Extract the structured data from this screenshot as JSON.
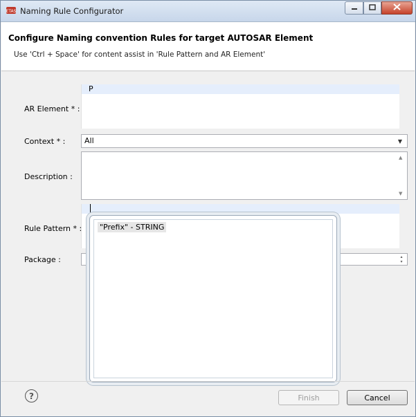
{
  "window": {
    "title": "Naming Rule Configurator",
    "icons": {
      "app": "app-logo-icon",
      "minimize": "minimize-icon",
      "maximize": "maximize-icon",
      "close": "close-icon"
    }
  },
  "header": {
    "title": "Configure Naming convention Rules for target AUTOSAR Element",
    "description": "Use  'Ctrl + Space' for content assist in 'Rule Pattern and AR Element'"
  },
  "form": {
    "ar_element": {
      "label": "AR Element * :",
      "value": "P"
    },
    "context": {
      "label": "Context * :",
      "value": "All"
    },
    "description": {
      "label": "Description :",
      "value": ""
    },
    "rule_pattern": {
      "label": "Rule Pattern * :",
      "value": ""
    },
    "package": {
      "label": "Package :",
      "value": ""
    }
  },
  "content_assist": {
    "proposals": [
      "\"Prefix\" - STRING"
    ]
  },
  "footer": {
    "help_icon": "help-icon",
    "finish_label": "Finish",
    "cancel_label": "Cancel"
  },
  "colors": {
    "accent": "#e5eefc",
    "close": "#c6432b"
  }
}
